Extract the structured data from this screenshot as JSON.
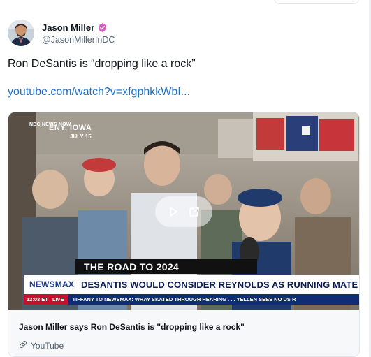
{
  "author": {
    "display_name": "Jason Miller",
    "handle": "@JasonMillerInDC",
    "verified": true,
    "verified_color": "#d65fbd"
  },
  "tweet": {
    "text": "Ron DeSantis is “dropping like a rock”",
    "link_text": "youtube.com/watch?v=xfgphkkWbI..."
  },
  "card": {
    "title": "Jason Miller says Ron DeSantis is \"dropping like a rock\"",
    "source": "YouTube",
    "video": {
      "bug": "NBC NEWS NOW",
      "location": "ENY, IOWA",
      "date": "JULY 15",
      "banner": "THE ROAD TO 2024",
      "network": "NEWSMAX",
      "headline": "DESANTIS WOULD CONSIDER REYNOLDS AS RUNNING MATE",
      "time": "12:03 ET",
      "live": "LIVE",
      "ticker": "TIFFANY TO NEWSMAX: WRAY SKATED THROUGH HEARING . . .     YELLEN SEES NO US R"
    }
  },
  "icons": {
    "play": "play-icon",
    "external": "external-link-icon",
    "link": "link-icon"
  },
  "colors": {
    "link": "#1d6fc4",
    "ticker_bg": "#0f2c74",
    "live_red": "#c8102e"
  }
}
